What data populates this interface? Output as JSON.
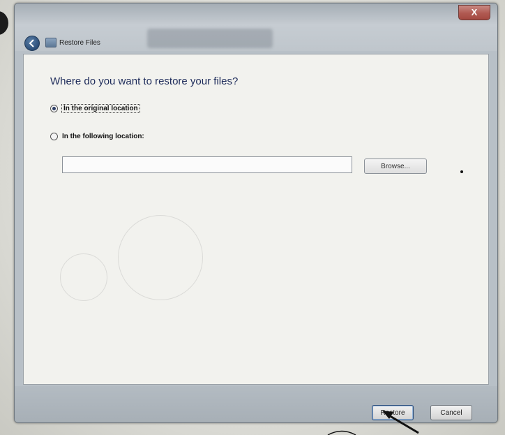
{
  "window": {
    "close_label": "X"
  },
  "nav": {
    "title": "Restore Files"
  },
  "main": {
    "heading": "Where do you want to restore your files?",
    "options": [
      {
        "label": "In the original location",
        "selected": true
      },
      {
        "label": "In the following location:",
        "selected": false
      }
    ],
    "location_value": "",
    "browse_label": "Browse..."
  },
  "footer": {
    "restore_label": "Restore",
    "cancel_label": "Cancel"
  },
  "icons": {
    "back": "back-arrow-icon",
    "app": "restore-files-icon",
    "pointer": "arrow-pointer-icon"
  },
  "colors": {
    "heading": "#1d2b5a",
    "close_button": "#b05a52",
    "window_frame": "#b8c0c7"
  }
}
